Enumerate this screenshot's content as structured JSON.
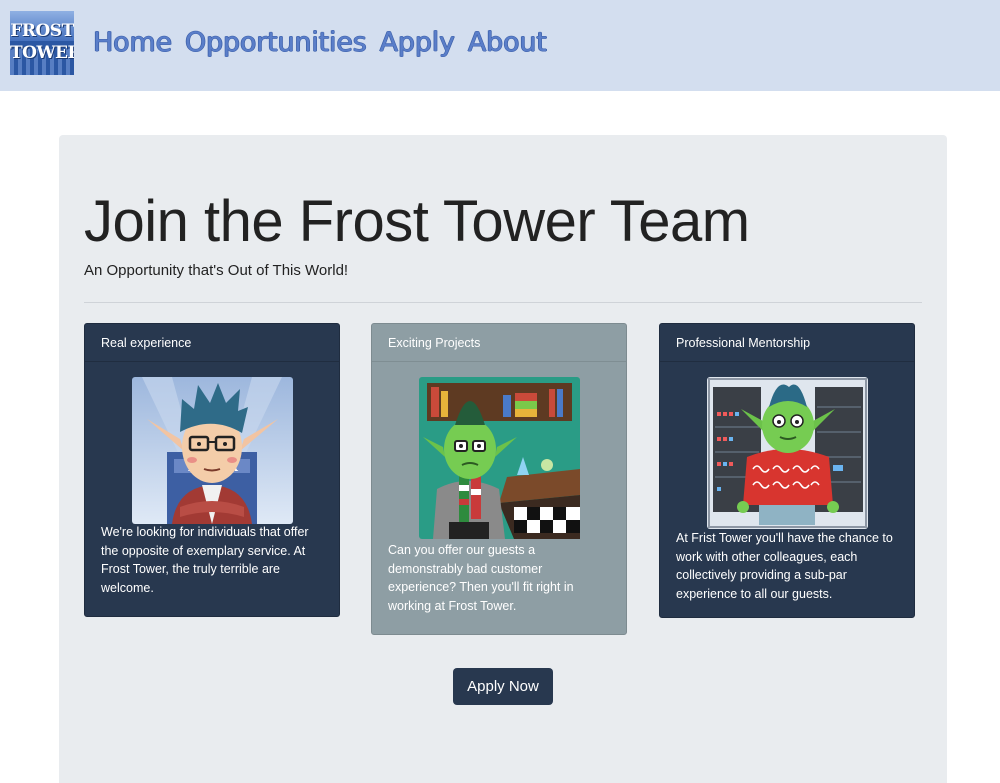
{
  "logo": {
    "line1": "FROST",
    "line2": "TOWER"
  },
  "nav": {
    "links": [
      "Home",
      "Opportunities",
      "Apply",
      "About"
    ]
  },
  "hero": {
    "title": "Join the Frost Tower Team",
    "subtitle": "An Opportunity that's Out of This World!"
  },
  "cards": [
    {
      "header": "Real experience",
      "illustration": "elf-with-glasses-avatar",
      "text": "We're looking for individuals that offer the opposite of exemplary service. At Frost Tower, the truly terrible are welcome."
    },
    {
      "header": "Exciting Projects",
      "illustration": "goblin-in-lab",
      "text": "Can you offer our guests a demonstrably bad customer experience? Then you'll fit right in working at Frost Tower."
    },
    {
      "header": "Professional Mentorship",
      "illustration": "goblin-in-server-room",
      "text": "At Frist Tower you'll have the chance to work with other colleagues, each collectively providing a sub-par experience to all our guests."
    }
  ],
  "apply_button": "Apply Now",
  "colors": {
    "navbar_bg": "#d3deef",
    "nav_link": "#5a7ec9",
    "jumbotron_bg": "#e9ecef",
    "card_dark": "#28384f",
    "card_gray": "#8e9ea4",
    "button_bg": "#28384f"
  }
}
